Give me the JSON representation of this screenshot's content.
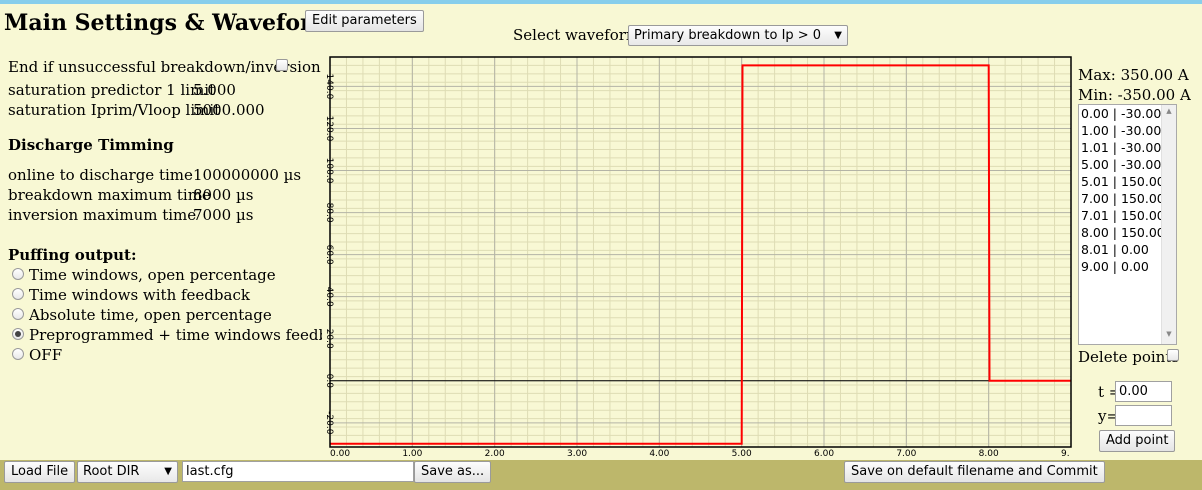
{
  "title": "Main Settings & Waveforms",
  "edit_params_label": "Edit parameters",
  "waveform_select": {
    "label": "Select waveform:",
    "value": "Primary breakdown to Ip > 0"
  },
  "settings": {
    "end_if_unsuccessful": {
      "label": "End if unsuccessful breakdown/inversion",
      "checked": false
    },
    "rows": [
      {
        "label": "saturation predictor 1 limit",
        "value": "5.000"
      },
      {
        "label": "saturation Iprim/Vloop limit",
        "value": "5000.000"
      }
    ]
  },
  "discharge_timing": {
    "heading": "Discharge Timming",
    "rows": [
      {
        "label": "online to discharge time",
        "value": "100000000 µs"
      },
      {
        "label": "breakdown maximum time",
        "value": "8000 µs"
      },
      {
        "label": "inversion maximum time",
        "value": "7000 µs"
      }
    ]
  },
  "puffing": {
    "heading": "Puffing output:",
    "options": [
      {
        "label": "Time windows, open percentage",
        "selected": false
      },
      {
        "label": "Time windows with feedback",
        "selected": false
      },
      {
        "label": "Absolute time, open percentage",
        "selected": false
      },
      {
        "label": "Preprogrammed + time windows feedback",
        "selected": true
      },
      {
        "label": "OFF",
        "selected": false
      }
    ]
  },
  "range": {
    "max": "Max: 350.00 A",
    "min": "Min: -350.00 A"
  },
  "points": [
    "0.00 | -30.00",
    "1.00 | -30.00",
    "1.01 | -30.00",
    "5.00 | -30.00",
    "5.01 | 150.00",
    "7.00 | 150.00",
    "7.01 | 150.00",
    "8.00 | 150.00",
    "8.01 | 0.00",
    "9.00 | 0.00"
  ],
  "delete_points_label": "Delete points",
  "t_label": "t =",
  "t_value": "0.00",
  "y_label": "y=",
  "y_value": "",
  "add_point_label": "Add point",
  "bottom": {
    "load_file": "Load File",
    "root_dir": "Root DIR",
    "filename": "last.cfg",
    "save_as": "Save as...",
    "save_commit": "Save on default filename and Commit"
  },
  "chart_data": {
    "type": "line",
    "series": [
      {
        "x": [
          0.0,
          1.0,
          1.01,
          5.0,
          5.01,
          7.0,
          7.01,
          8.0,
          8.01,
          9.0
        ],
        "y": [
          -30.0,
          -30.0,
          -30.0,
          -30.0,
          150.0,
          150.0,
          150.0,
          150.0,
          0.0,
          0.0
        ]
      }
    ],
    "x_ticks": [
      "0.00",
      "1.00",
      "2.00",
      "3.00",
      "4.00",
      "5.00",
      "6.00",
      "7.00",
      "8.00",
      "9."
    ],
    "y_ticks": [
      "-20.0",
      "0.0",
      "20.0",
      "40.0",
      "60.0",
      "80.0",
      "100.0",
      "120.0",
      "140.0"
    ],
    "xlim": [
      0,
      9
    ],
    "ylim": [
      -31.5,
      154
    ],
    "grid": true,
    "line_color": "#ff0000"
  }
}
